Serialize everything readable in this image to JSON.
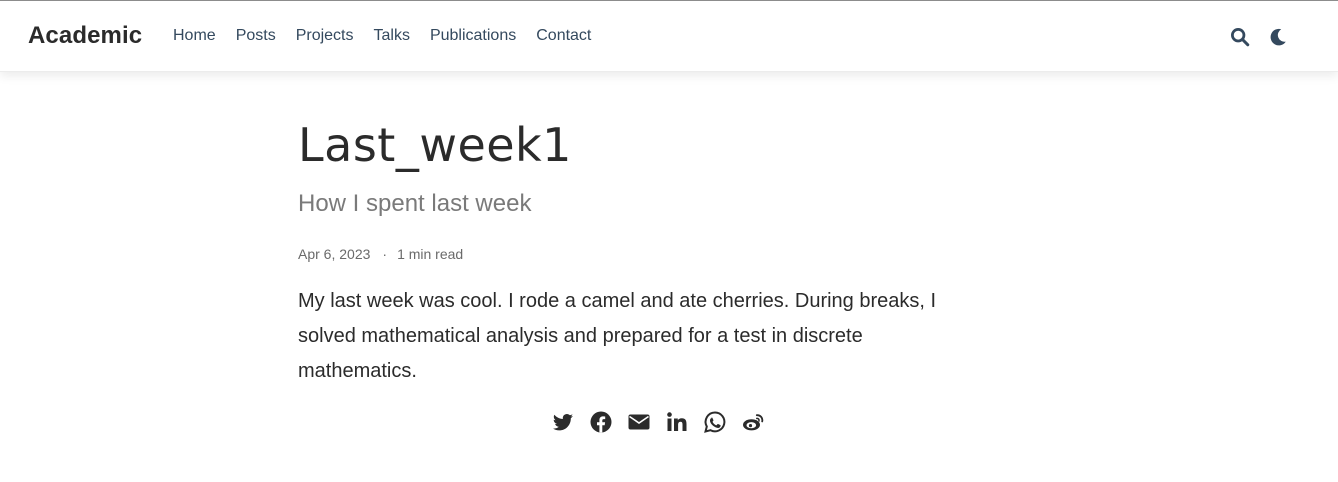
{
  "site": {
    "brand": "Academic"
  },
  "nav": {
    "items": [
      {
        "label": "Home"
      },
      {
        "label": "Posts"
      },
      {
        "label": "Projects"
      },
      {
        "label": "Talks"
      },
      {
        "label": "Publications"
      },
      {
        "label": "Contact"
      }
    ],
    "icons": [
      "search-icon",
      "moon-icon"
    ]
  },
  "post": {
    "title": "Last_week1",
    "subtitle": "How I spent last week",
    "date": "Apr 6, 2023",
    "separator": "·",
    "reading_time": "1 min read",
    "body": "My last week was cool. I rode a camel and ate cherries. During breaks, I solved mathematical analysis and prepared for a test in discrete mathematics."
  },
  "share": {
    "icons": [
      "twitter-icon",
      "facebook-icon",
      "email-icon",
      "linkedin-icon",
      "whatsapp-icon",
      "weibo-icon"
    ]
  },
  "colors": {
    "text": "#2b2b2b",
    "nav_link": "#34495e",
    "muted": "#7a7a7a",
    "icon": "#34495e"
  }
}
